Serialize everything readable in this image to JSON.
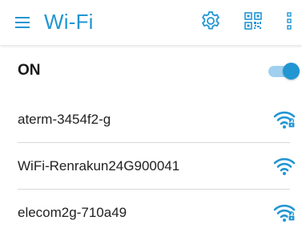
{
  "appbar": {
    "title": "Wi-Fi",
    "menu_icon": "hamburger-menu-icon",
    "settings_icon": "gear-icon",
    "qr_icon": "qr-code-icon",
    "more_icon": "more-vertical-icon",
    "accent_color": "#2196d3"
  },
  "wifi_toggle": {
    "label": "ON",
    "state": "on"
  },
  "networks": [
    {
      "name": "aterm-3454f2-g",
      "secured": true,
      "signal": "full"
    },
    {
      "name": "WiFi-Renrakun24G900041",
      "secured": false,
      "signal": "full"
    },
    {
      "name": "elecom2g-710a49",
      "secured": true,
      "signal": "full"
    }
  ]
}
